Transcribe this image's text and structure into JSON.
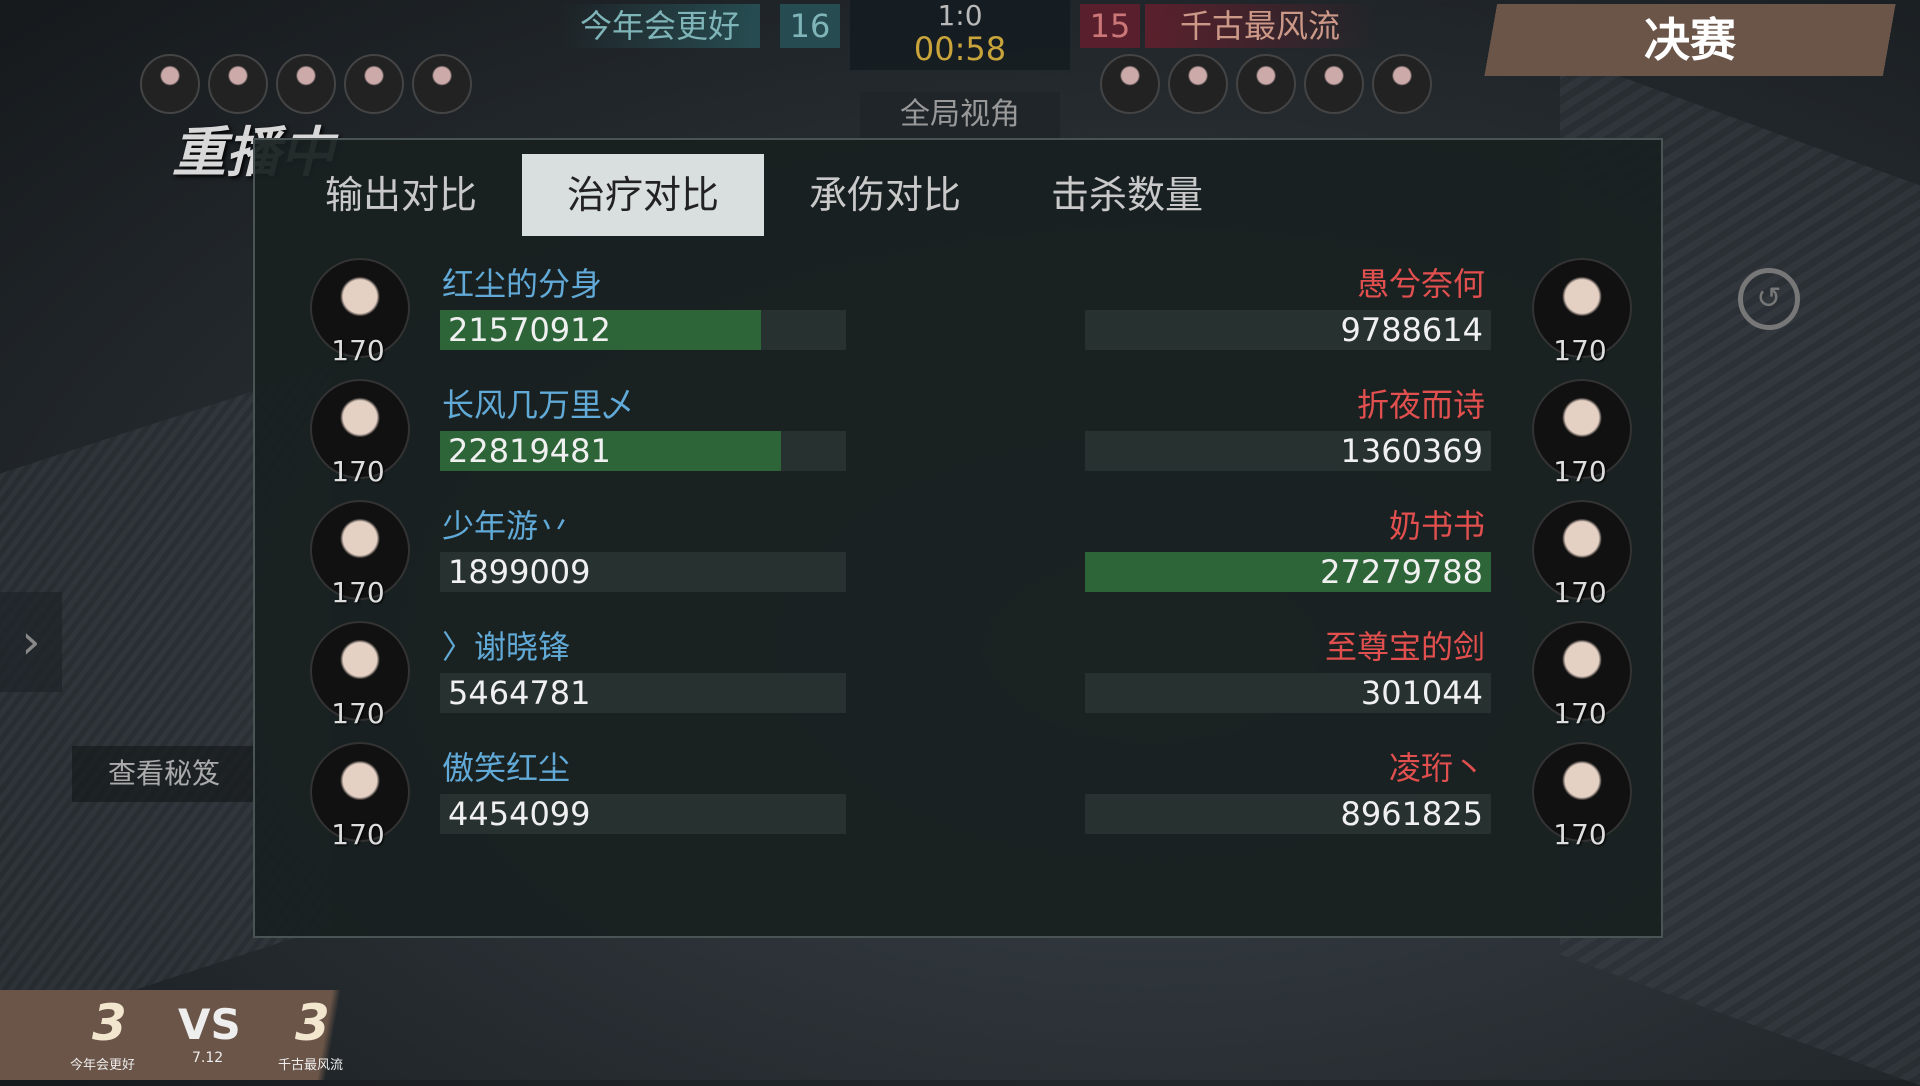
{
  "hud": {
    "team_left": "今年会更好",
    "team_left_kills": "16",
    "round_score": "1:0",
    "timer": "00:58",
    "team_right_kills": "15",
    "team_right": "千古最风流",
    "view_button": "全局视角",
    "final_label": "决赛",
    "replay_label": "重播中",
    "secret_button": "查看秘笈",
    "accent_left": "#61a9d6",
    "accent_right": "#e24f4f",
    "timer_color": "#c9a43b"
  },
  "tabs": [
    {
      "label": "输出对比",
      "active": false
    },
    {
      "label": "治疗对比",
      "active": true
    },
    {
      "label": "承伤对比",
      "active": false
    },
    {
      "label": "击杀数量",
      "active": false
    }
  ],
  "left_players": [
    {
      "name": "红尘的分身",
      "value": "21570912",
      "level": "170",
      "fill": 0.79
    },
    {
      "name": "长风几万里乄",
      "value": "22819481",
      "level": "170",
      "fill": 0.84
    },
    {
      "name": "少年游丷",
      "value": "1899009",
      "level": "170",
      "fill": 0.0
    },
    {
      "name": "〉谢晓锋",
      "value": "5464781",
      "level": "170",
      "fill": 0.0
    },
    {
      "name": "傲笑红尘",
      "value": "4454099",
      "level": "170",
      "fill": 0.0
    }
  ],
  "right_players": [
    {
      "name": "愚兮奈何",
      "value": "9788614",
      "level": "170",
      "fill": 0.0
    },
    {
      "name": "折夜而诗",
      "value": "1360369",
      "level": "170",
      "fill": 0.0
    },
    {
      "name": "奶书书",
      "value": "27279788",
      "level": "170",
      "fill": 1.0
    },
    {
      "name": "至尊宝的剑",
      "value": "301044",
      "level": "170",
      "fill": 0.0
    },
    {
      "name": "凌珩丶",
      "value": "8961825",
      "level": "170",
      "fill": 0.0
    }
  ],
  "bottom_score": {
    "left_score": "3",
    "vs": "VS",
    "date": "7.12",
    "right_score": "3",
    "left_team": "今年会更好",
    "right_team": "千古最风流"
  }
}
